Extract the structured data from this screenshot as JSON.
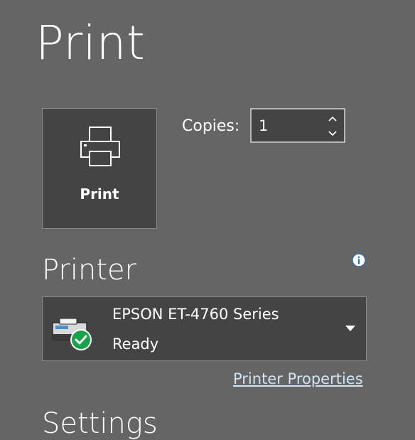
{
  "page": {
    "title": "Print"
  },
  "print_button": {
    "label": "Print",
    "icon": "printer-icon"
  },
  "copies": {
    "label": "Copies:",
    "value": "1"
  },
  "printer": {
    "section_title": "Printer",
    "info_icon": "info-icon",
    "selected_name": "EPSON ET-4760 Series",
    "selected_status": "Ready",
    "status_icon": "printer-ready-icon",
    "properties_link": "Printer Properties"
  },
  "settings": {
    "section_title": "Settings"
  },
  "colors": {
    "background": "#656565",
    "panel": "#444444",
    "link": "#cfe3f4",
    "status_ok": "#16a34a"
  }
}
